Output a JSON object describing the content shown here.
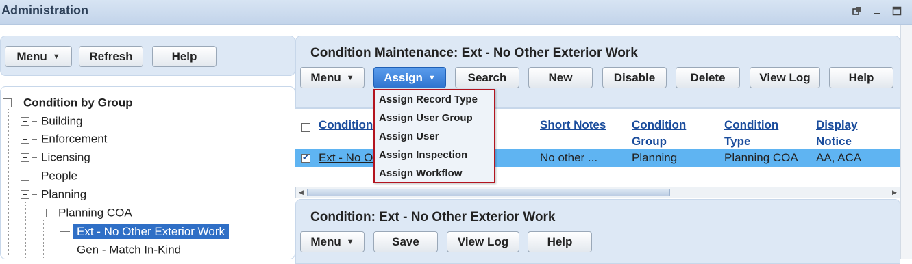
{
  "window": {
    "title": "Administration",
    "icons": [
      "restore-icon",
      "minimize-icon",
      "maximize-icon"
    ]
  },
  "left_toolbar": {
    "menu_label": "Menu",
    "refresh_label": "Refresh",
    "help_label": "Help"
  },
  "tree": {
    "root": "Condition by Group",
    "items": [
      {
        "label": "Building",
        "state": "collapsed"
      },
      {
        "label": "Enforcement",
        "state": "collapsed"
      },
      {
        "label": "Licensing",
        "state": "collapsed"
      },
      {
        "label": "People",
        "state": "collapsed"
      },
      {
        "label": "Planning",
        "state": "expanded"
      }
    ],
    "sub_group": "Planning COA",
    "leaves": [
      "Ext - No Other Exterior Work",
      "Gen - Match In-Kind"
    ],
    "selected_leaf": "Ext - No Other Exterior Work"
  },
  "maintenance": {
    "title": "Condition Maintenance: Ext - No Other Exterior Work",
    "toolbar": {
      "menu_label": "Menu",
      "assign_label": "Assign",
      "search_label": "Search",
      "new_label": "New",
      "disable_label": "Disable",
      "delete_label": "Delete",
      "view_log_label": "View Log",
      "help_label": "Help"
    },
    "assign_menu": [
      "Assign Record Type",
      "Assign User Group",
      "Assign User",
      "Assign Inspection",
      "Assign Workflow"
    ],
    "table": {
      "columns": [
        {
          "line1": "Condition",
          "line2": ""
        },
        {
          "line1": "Short Notes",
          "line2": ""
        },
        {
          "line1": "Condition",
          "line2": "Group"
        },
        {
          "line1": "Condition",
          "line2": "Type"
        },
        {
          "line1": "Display",
          "line2": "Notice"
        }
      ],
      "rows": [
        {
          "checked": true,
          "condition": "Ext - No O",
          "short_notes": "No other ...",
          "group": "Planning",
          "type": "Planning COA",
          "notice": "AA, ACA"
        }
      ]
    }
  },
  "detail": {
    "title": "Condition: Ext - No Other Exterior Work",
    "toolbar": {
      "menu_label": "Menu",
      "save_label": "Save",
      "view_log_label": "View Log",
      "help_label": "Help"
    }
  },
  "colors": {
    "accent": "#2f74cf",
    "selection": "#5fb4f2",
    "tree_selection": "#2f6fc6",
    "menu_border": "#b3141f",
    "link": "#1a4c9c"
  }
}
